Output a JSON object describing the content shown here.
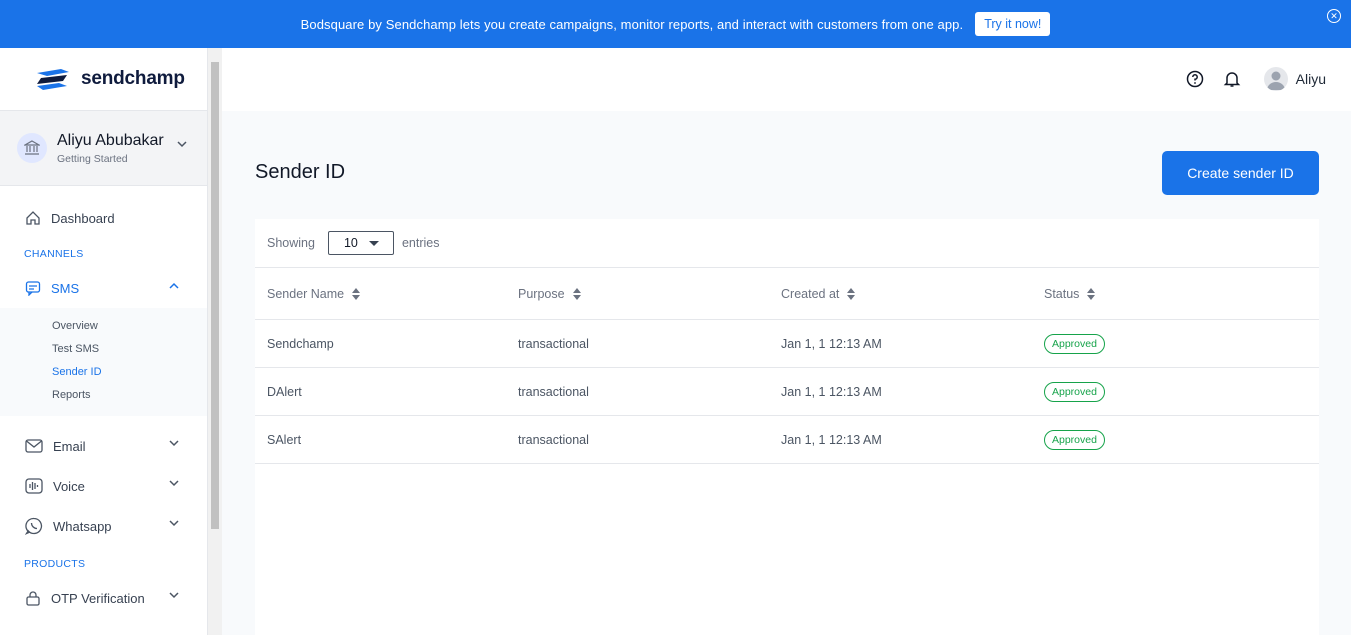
{
  "banner": {
    "text": "Bodsquare by Sendchamp lets you create campaigns, monitor reports, and interact with customers from one app.",
    "cta": "Try it now!"
  },
  "brand": {
    "name": "sendchamp"
  },
  "account": {
    "name": "Aliyu Abubakar",
    "subtitle": "Getting Started"
  },
  "sidebar": {
    "dashboard": "Dashboard",
    "channels_heading": "CHANNELS",
    "sms": "SMS",
    "sms_sub": [
      "Overview",
      "Test SMS",
      "Sender ID",
      "Reports"
    ],
    "email": "Email",
    "voice": "Voice",
    "whatsapp": "Whatsapp",
    "products_heading": "PRODUCTS",
    "otp": "OTP Verification"
  },
  "header": {
    "user_name": "Aliyu"
  },
  "main": {
    "title": "Sender ID",
    "create_button": "Create sender ID",
    "showing_label": "Showing",
    "page_size": "10",
    "entries_label": "entries",
    "columns": [
      "Sender Name",
      "Purpose",
      "Created at",
      "Status"
    ],
    "rows": [
      {
        "name": "Sendchamp",
        "purpose": "transactional",
        "created": "Jan 1, 1 12:13 AM",
        "status": "Approved"
      },
      {
        "name": "DAlert",
        "purpose": "transactional",
        "created": "Jan 1, 1 12:13 AM",
        "status": "Approved"
      },
      {
        "name": "SAlert",
        "purpose": "transactional",
        "created": "Jan 1, 1 12:13 AM",
        "status": "Approved"
      }
    ]
  },
  "colors": {
    "primary": "#1a73e8",
    "approved": "#16a34a",
    "brand_navy": "#0f1b3d"
  }
}
